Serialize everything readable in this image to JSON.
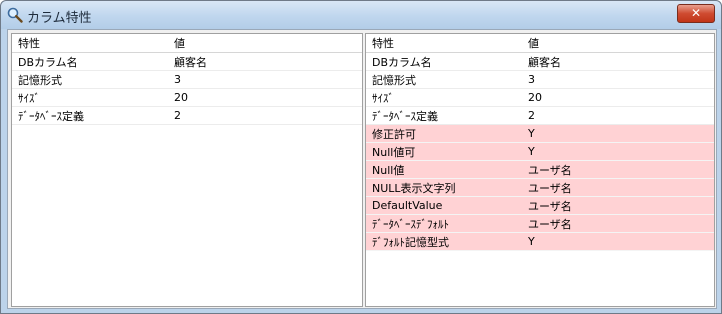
{
  "window": {
    "title": "カラム特性",
    "close_label": "✕"
  },
  "headers": {
    "property": "特性",
    "value": "値"
  },
  "left_rows": [
    {
      "name": "DBカラム名",
      "value": "顧客名"
    },
    {
      "name": "記憶形式",
      "value": "3"
    },
    {
      "name": "ｻｲｽﾞ",
      "value": "20"
    },
    {
      "name": "ﾃﾞｰﾀﾍﾞｰｽ定義",
      "value": "2"
    }
  ],
  "right_rows": [
    {
      "name": "DBカラム名",
      "value": "顧客名"
    },
    {
      "name": "記憶形式",
      "value": "3"
    },
    {
      "name": "ｻｲｽﾞ",
      "value": "20"
    },
    {
      "name": "ﾃﾞｰﾀﾍﾞｰｽ定義",
      "value": "2"
    },
    {
      "name": "修正許可",
      "value": "Y"
    },
    {
      "name": "Null値可",
      "value": "Y"
    },
    {
      "name": "Null値",
      "value": "ユーザ名"
    },
    {
      "name": "NULL表示文字列",
      "value": "ユーザ名"
    },
    {
      "name": "DefaultValue",
      "value": "ユーザ名"
    },
    {
      "name": "ﾃﾞｰﾀﾍﾞｰｽﾃﾞﾌｫﾙﾄ",
      "value": "ユーザ名"
    },
    {
      "name": "ﾃﾞﾌｫﾙﾄ記憶型式",
      "value": "Y"
    }
  ],
  "highlight_color": "#ffd2d4",
  "icons": {
    "title": "search-icon",
    "close": "close-icon"
  }
}
